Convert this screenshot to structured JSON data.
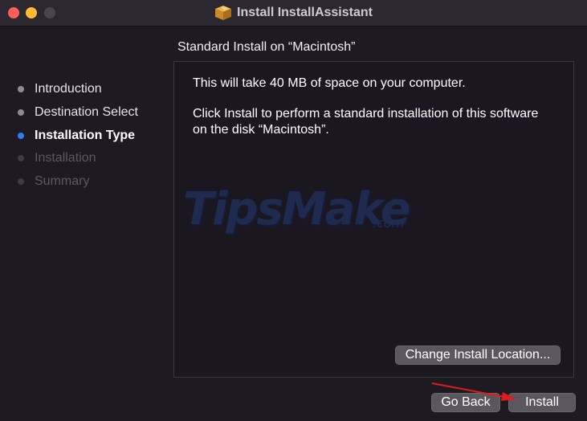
{
  "window": {
    "title": "Install InstallAssistant",
    "icon": "package-icon"
  },
  "sidebar": {
    "steps": [
      {
        "label": "Introduction",
        "state": "done"
      },
      {
        "label": "Destination Select",
        "state": "done"
      },
      {
        "label": "Installation Type",
        "state": "current"
      },
      {
        "label": "Installation",
        "state": "future"
      },
      {
        "label": "Summary",
        "state": "future"
      }
    ]
  },
  "main": {
    "header": "Standard Install on “Macintosh”",
    "line1": "This will take 40 MB of space on your computer.",
    "line2": "Click Install to perform a standard installation of this software",
    "line3": "on the disk “Macintosh”.",
    "change_location_label": "Change Install Location..."
  },
  "footer": {
    "go_back_label": "Go Back",
    "install_label": "Install"
  },
  "watermark": {
    "text": "TipsMake",
    "suffix": ".com"
  },
  "colors": {
    "accent": "#2f7cf6",
    "annotation_arrow": "#e01b1b"
  }
}
